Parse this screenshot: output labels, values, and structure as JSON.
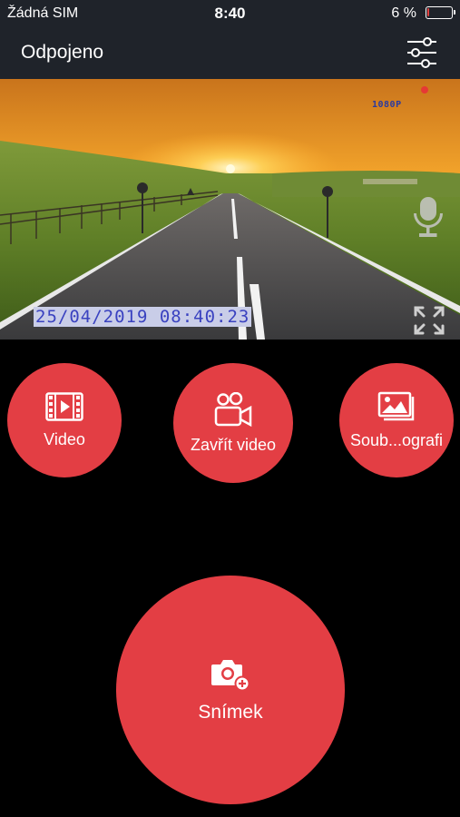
{
  "status_bar": {
    "carrier": "Žádná SIM",
    "time": "8:40",
    "battery_percent": "6 %",
    "battery_level": 0.06,
    "battery_color": "#e0403f"
  },
  "nav": {
    "title": "Odpojeno",
    "settings_icon": "sliders-icon"
  },
  "video": {
    "resolution": "1080P",
    "timestamp": "25/04/2019 08:40:23",
    "recording_indicator_color": "#e53935",
    "mic_icon": "microphone-icon",
    "fullscreen_icon": "expand-icon"
  },
  "actions": {
    "video_label": "Video",
    "close_video_label": "Zavřít video",
    "files_label": "Soub...ografi",
    "snapshot_label": "Snímek"
  },
  "colors": {
    "accent": "#e33e44",
    "bar": "#1f232a",
    "background": "#000000"
  }
}
